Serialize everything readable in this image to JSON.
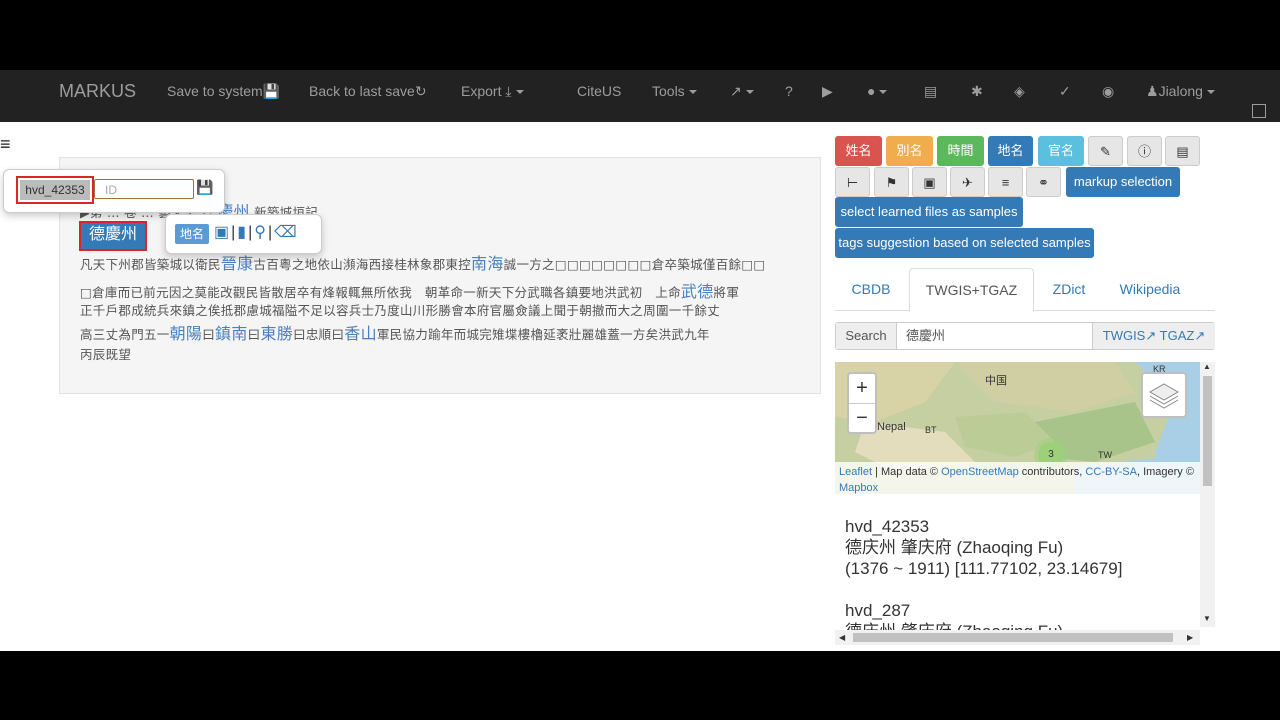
{
  "navbar": {
    "brand": "MARKUS",
    "save": "Save to system",
    "back": "Back to last save",
    "export": "Export",
    "citeus": "CiteUS",
    "tools": "Tools",
    "help": "?",
    "user": "Jialong"
  },
  "document": {
    "line1_pre": "▶第 … 卷 … 藝文志",
    "line1_hl": "德慶州",
    "line1_post": "新築城垣記",
    "line3_a": "凡天下州郡皆築城以衛民",
    "line3_hl1": "晉康",
    "line3_b": "古百粵之地依山瀕海西接桂林象郡東控",
    "line3_hl2": "南海",
    "line3_c": "誠一方之□□□□□□□□倉卒築城僅百餘□□",
    "line4_a": "□倉庫而已前元因之莫能改觀民皆散居卒有烽報輒無所依我　朝革命一新天下分武職各鎮要地洪武初　上命",
    "line4_hl": "武德",
    "line4_b": "將軍",
    "line5": "正千戶郡成統兵來鎮之俟抵郡慮城福隘不足以容兵士乃度山川形勝會本府官屬僉議上聞于朝撤而大之周圍一千餘丈",
    "line6_a": "高三丈為門五一",
    "line6_hl1": "朝陽",
    "line6_b": "曰",
    "line6_hl2": "鎮南",
    "line6_c": "曰",
    "line6_hl3": "東勝",
    "line6_d": "曰忠順曰",
    "line6_hl4": "香山",
    "line6_e": "軍民協力踰年而城完雉堞樓櫓延袤壯麗雄蓋一方矣洪武九年",
    "line7": "丙辰既望",
    "selected_mark": "德慶州"
  },
  "popover_id": {
    "badge": "hvd_42353",
    "placeholder": "ID"
  },
  "popover_tag": {
    "label": "地名"
  },
  "tag_buttons": {
    "b1": "姓名",
    "b2": "別名",
    "b3": "時間",
    "b4": "地名",
    "b5": "官名",
    "markup": "markup selection",
    "select_learned": "select learned files as samples",
    "suggest": "tags suggestion based on selected samples"
  },
  "tabs": [
    "CBDB",
    "TWGIS+TGAZ",
    "ZDict",
    "Wikipedia"
  ],
  "search": {
    "addon": "Search",
    "value": "德慶州",
    "link1": "TWGIS",
    "link2": "TGAZ"
  },
  "map": {
    "label_china": "中国",
    "label_nepal": "Nepal",
    "label_bt": "BT",
    "label_tw": "TW",
    "label_kr": "KR",
    "cluster": "3",
    "attr_leaflet": "Leaflet",
    "attr_text1": " | Map data © ",
    "attr_osm": "OpenStreetMap",
    "attr_text2": " contributors, ",
    "attr_cc": "CC-BY-SA",
    "attr_text3": ", Imagery © ",
    "attr_mapbox": "Mapbox"
  },
  "results": [
    {
      "id": "hvd_42353",
      "name": "德庆州 肇庆府 (Zhaoqing Fu)",
      "range": "(1376 ~ 1911) [111.77102, 23.14679]"
    },
    {
      "id": "hvd_287",
      "name": "德庆州 肇庆府 (Zhaoqing Fu)",
      "range": ""
    }
  ],
  "colors": {
    "red": "#d9534f",
    "orange": "#f0ad4e",
    "green": "#5cb85c",
    "blue": "#337ab7",
    "cyan": "#5bc0de"
  }
}
